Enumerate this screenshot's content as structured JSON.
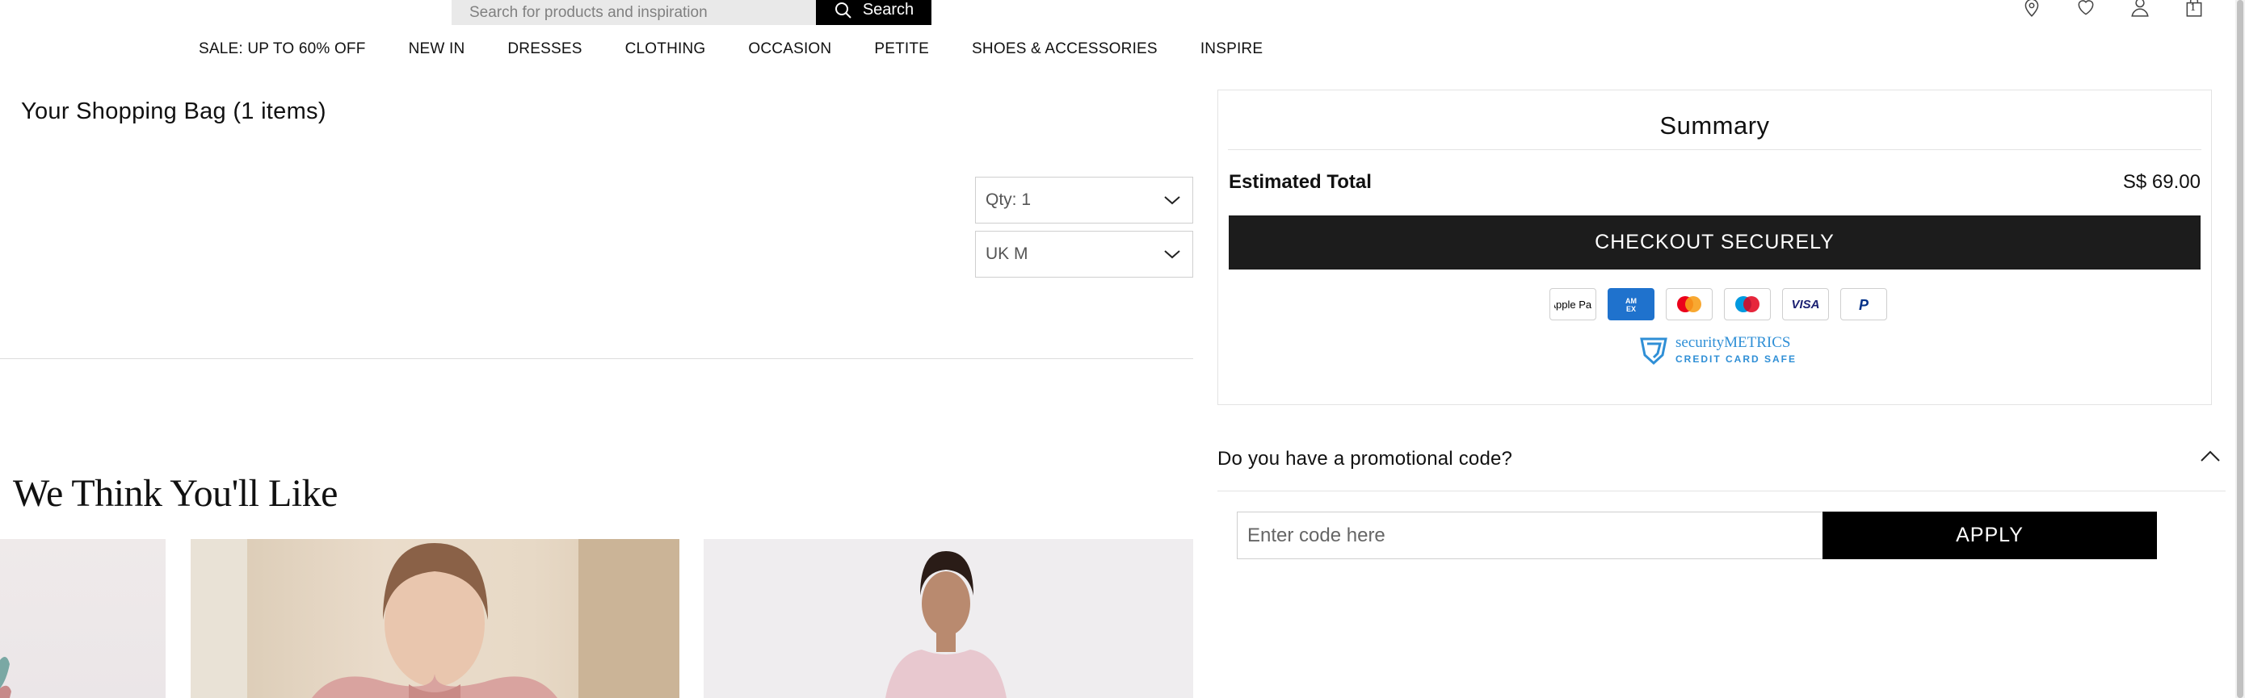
{
  "header": {
    "search": {
      "placeholder": "Search for products and inspiration",
      "button_label": "Search"
    },
    "icons": [
      "location-pin-icon",
      "heart-icon",
      "account-icon",
      "bag-icon"
    ],
    "bag_count": "1"
  },
  "nav": {
    "items": [
      {
        "label": "SALE: UP TO 60% OFF"
      },
      {
        "label": "NEW IN"
      },
      {
        "label": "DRESSES"
      },
      {
        "label": "CLOTHING"
      },
      {
        "label": "OCCASION"
      },
      {
        "label": "PETITE"
      },
      {
        "label": "SHOES & ACCESSORIES"
      },
      {
        "label": "INSPIRE"
      }
    ]
  },
  "bag": {
    "title": "Your Shopping Bag (1 items)",
    "item": {
      "qty_label": "Qty: 1",
      "size_label": "UK M"
    }
  },
  "recommendations": {
    "title": "We Think You'll Like"
  },
  "summary": {
    "title": "Summary",
    "estimated_total_label": "Estimated Total",
    "estimated_total_value": "S$ 69.00",
    "checkout_label": "CHECKOUT SECURELY",
    "payment_methods": [
      "Apple Pay",
      "American Express",
      "Mastercard",
      "Maestro",
      "VISA",
      "PayPal"
    ],
    "security_badge": {
      "line1": "securityMETRICS",
      "line2": "CREDIT CARD SAFE"
    }
  },
  "promo": {
    "question": "Do you have a promotional code?",
    "input_placeholder": "Enter code here",
    "apply_label": "APPLY"
  },
  "colors": {
    "primary_button": "#1c1c1c",
    "security_blue": "#2f8fd6"
  }
}
